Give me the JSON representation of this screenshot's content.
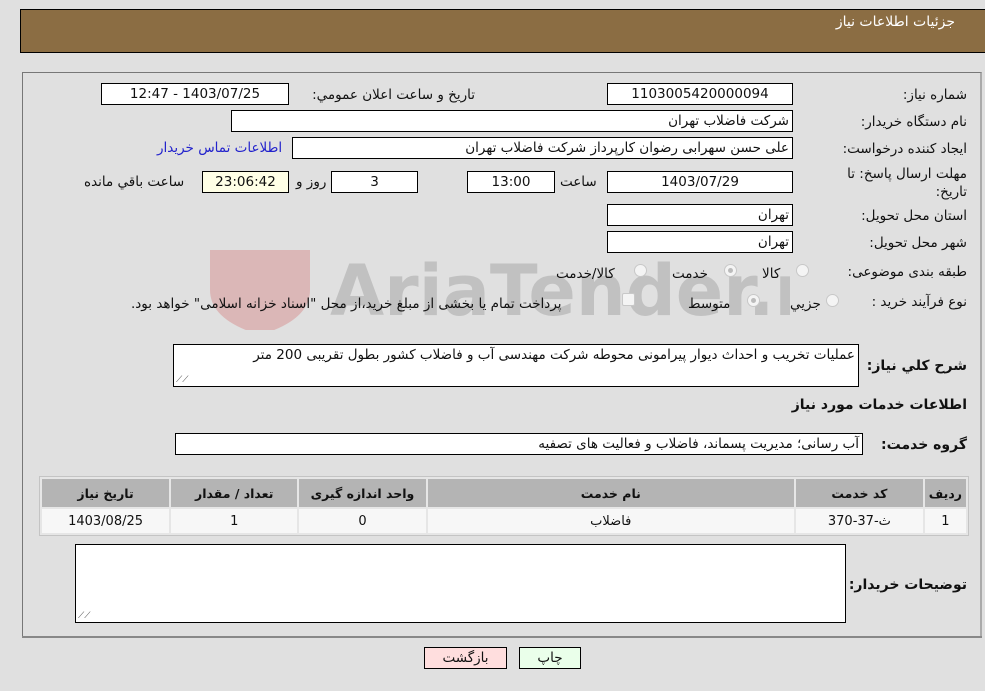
{
  "header": {
    "title": "جزئیات اطلاعات نیاز"
  },
  "fields": {
    "need_number": {
      "label": "شماره نیاز:",
      "value": "1103005420000094"
    },
    "announce_datetime": {
      "label": "تاریخ و ساعت اعلان عمومي:",
      "value": "1403/07/25 - 12:47"
    },
    "buyer_org": {
      "label": "نام دستگاه خريدار:",
      "value": "شرکت فاضلاب تهران"
    },
    "requester": {
      "label": "ايجاد کننده درخواست:",
      "value": "علی حسن  سهرابی رضوان کارپرداز شرکت فاضلاب تهران"
    },
    "buyer_contact_link": "اطلاعات تماس خريدار",
    "deadline": {
      "label": "مهلت ارسال پاسخ: تا تاریخ:",
      "date": "1403/07/29",
      "time_label": "ساعت",
      "time": "13:00",
      "days": "3",
      "days_label": "روز و",
      "remaining": "23:06:42",
      "remaining_label": "ساعت باقي مانده"
    },
    "province": {
      "label": "استان محل تحويل:",
      "value": "تهران"
    },
    "city": {
      "label": "شهر محل تحويل:",
      "value": "تهران"
    },
    "category": {
      "label": "طبقه بندی موضوعی:",
      "options": [
        "کالا",
        "خدمت",
        "کالا/خدمت"
      ],
      "selected": "خدمت"
    },
    "purchase_type": {
      "label": "نوع فرآيند خريد :",
      "options": [
        "جزيي",
        "متوسط"
      ],
      "selected": "متوسط",
      "treasury_note": "پرداخت تمام يا بخشی از مبلغ خريد،از محل \"اسناد خزانه اسلامی\" خواهد بود.",
      "treasury_checked": false
    },
    "description": {
      "label": "شرح کلي نياز:",
      "value": "عملیات تخریب و احداث دیوار پیرامونی محوطه شرکت مهندسی آب و فاضلاب کشور بطول تقریبی 200 متر"
    },
    "services_section_title": "اطلاعات خدمات مورد نياز",
    "service_group": {
      "label": "گروه خدمت:",
      "value": "آب رسانی؛ مديريت پسماند، فاضلاب و فعاليت های تصفيه"
    }
  },
  "services_table": {
    "headers": [
      "رديف",
      "کد خدمت",
      "نام خدمت",
      "واحد اندازه گيری",
      "تعداد / مقدار",
      "تاريخ نياز"
    ],
    "rows": [
      [
        "1",
        "ث-37-370",
        "فاضلاب",
        "0",
        "1",
        "1403/08/25"
      ]
    ]
  },
  "buyer_notes": {
    "label": "توضيحات خريدار:",
    "value": ""
  },
  "buttons": {
    "print": "چاپ",
    "back": "بازگشت"
  },
  "colors": {
    "header_bg": "#8b6d43",
    "print_bg": "#eaffea",
    "back_bg": "#ffdede",
    "link": "#2222cc"
  },
  "watermark": "AriaTender.neT"
}
